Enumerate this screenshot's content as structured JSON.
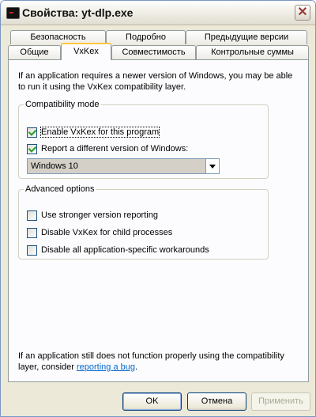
{
  "window": {
    "title": "Свойства: yt-dlp.exe"
  },
  "tabs": {
    "row1": [
      "Безопасность",
      "Подробно",
      "Предыдущие версии"
    ],
    "row2": [
      "Общие",
      "VxKex",
      "Совместимость",
      "Контрольные суммы"
    ],
    "active": "VxKex"
  },
  "panel": {
    "intro": "If an application requires a newer version of Windows, you may be able to run it using the VxKex compatibility layer.",
    "compat_group": {
      "legend": "Compatibility mode",
      "enable_label": "Enable VxKex for this program",
      "enable_checked": true,
      "report_label": "Report a different version of Windows:",
      "report_checked": true,
      "version_selected": "Windows 10"
    },
    "advanced_group": {
      "legend": "Advanced options",
      "options": [
        {
          "label": "Use stronger version reporting",
          "checked": false
        },
        {
          "label": "Disable VxKex for child processes",
          "checked": false
        },
        {
          "label": "Disable all application-specific workarounds",
          "checked": false
        }
      ]
    },
    "footer_text": "If an application still does not function properly using the compatibility layer, consider",
    "footer_link": "reporting a bug",
    "footer_end": "."
  },
  "buttons": {
    "ok": "OK",
    "cancel": "Отмена",
    "apply": "Применить"
  },
  "icons": {
    "app": "console-app-icon",
    "close": "close-icon"
  }
}
